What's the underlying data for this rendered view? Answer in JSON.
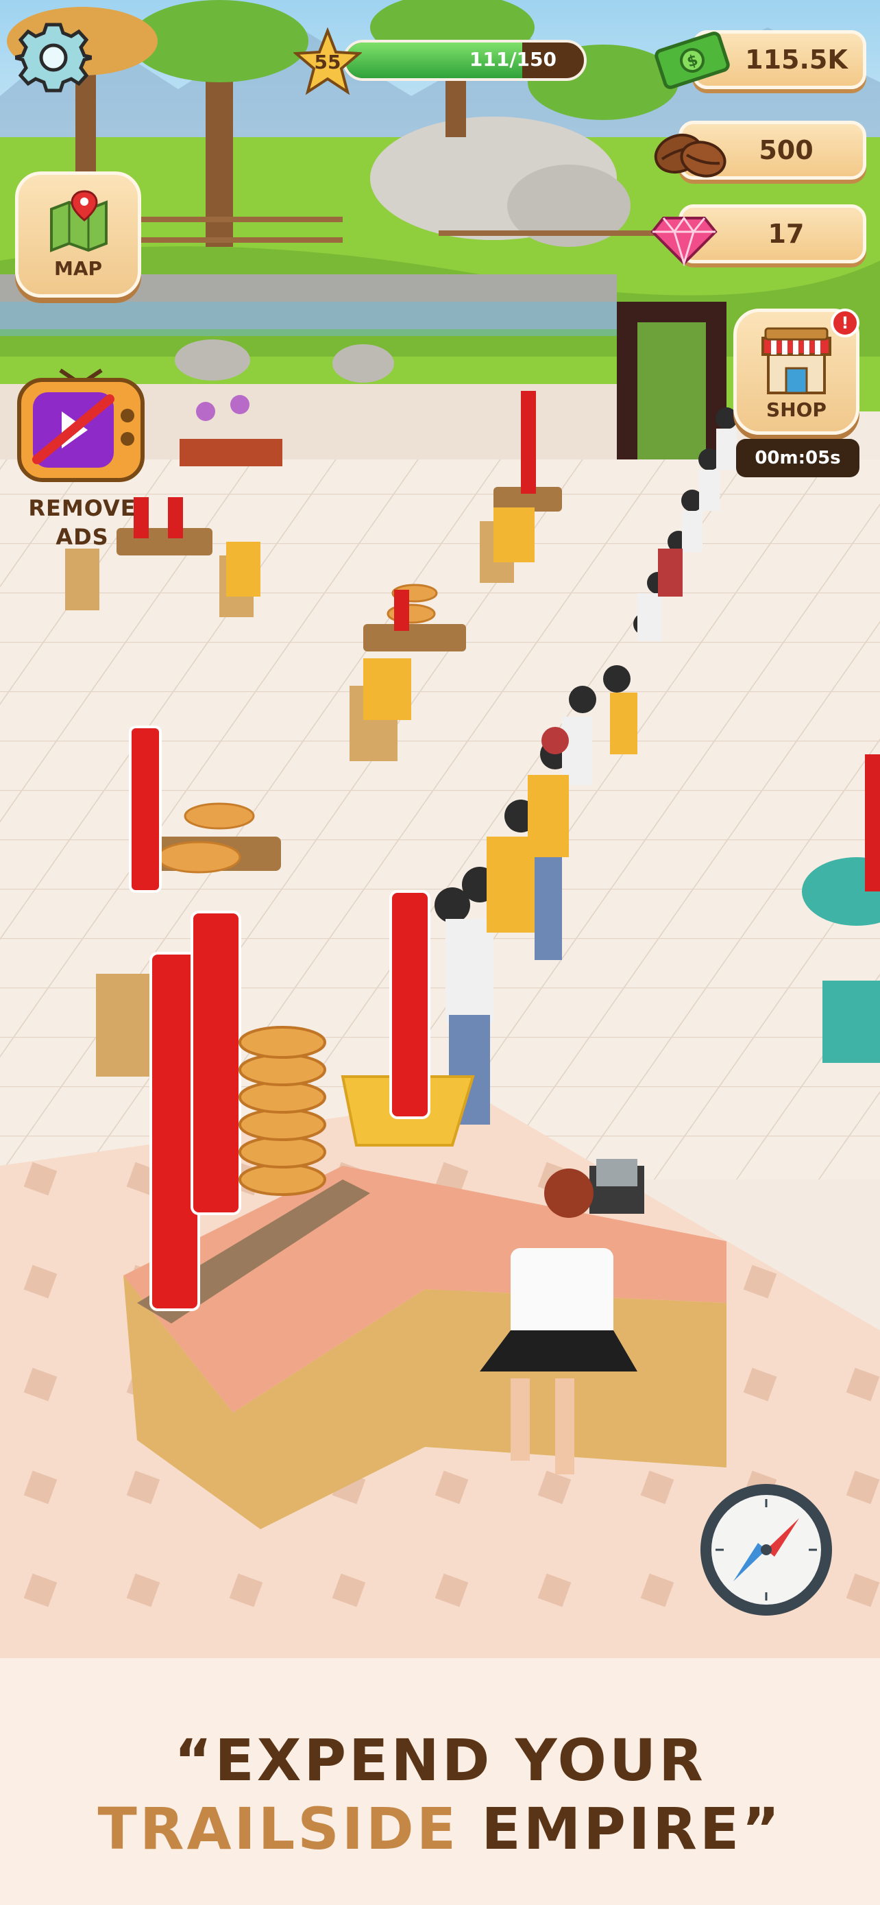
{
  "hud": {
    "level": "55",
    "xp_text": "111/150",
    "xp_progress": 0.74,
    "money": "115.5K",
    "coffee_beans": "500",
    "gems": "17"
  },
  "buttons": {
    "map_label": "MAP",
    "remove_ads_line1": "REMOVE",
    "remove_ads_line2": "ADS",
    "shop_label": "SHOP",
    "shop_badge": "!",
    "shop_timer": "00m:05s"
  },
  "banner": {
    "line1": "“EXPEND YOUR",
    "line2_a": "TRAILSIDE",
    "line2_b": "EMPIRE”"
  },
  "colors": {
    "brown": "#5a3416",
    "accent_brown": "#c58745",
    "xp_green": "#2fa23a",
    "alert_red": "#e22b2b"
  }
}
